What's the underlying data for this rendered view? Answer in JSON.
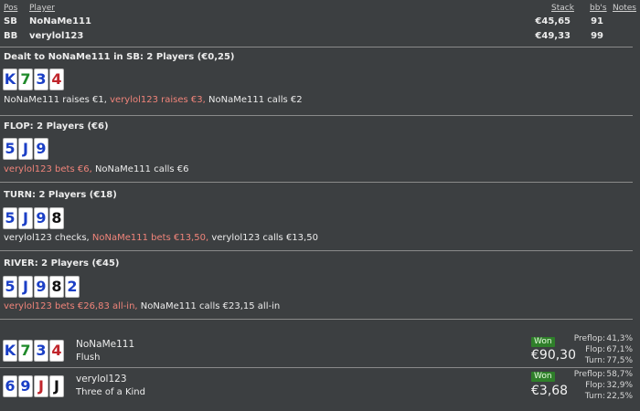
{
  "header": {
    "pos": "Pos",
    "player": "Player",
    "stack": "Stack",
    "bbs": "bb's",
    "notes": "Notes"
  },
  "players": [
    {
      "pos": "SB",
      "name": "NoNaMe111",
      "stack": "€45,65",
      "bbs": "91"
    },
    {
      "pos": "BB",
      "name": "verylol123",
      "stack": "€49,33",
      "bbs": "99"
    }
  ],
  "preflop": {
    "title": "Dealt to NoNaMe111 in SB: 2 Players (€0,25)",
    "cards": [
      {
        "rank": "K",
        "color": "blue"
      },
      {
        "rank": "7",
        "color": "green"
      },
      {
        "rank": "3",
        "color": "blue"
      },
      {
        "rank": "4",
        "color": "red"
      }
    ],
    "actions": [
      {
        "text": "NoNaMe111 raises €1,",
        "hl": false
      },
      {
        "text": "verylol123 raises €3,",
        "hl": true
      },
      {
        "text": "NoNaMe111 calls €2",
        "hl": false
      }
    ]
  },
  "flop": {
    "title": "FLOP: 2 Players (€6)",
    "cards": [
      {
        "rank": "5",
        "color": "blue"
      },
      {
        "rank": "J",
        "color": "blue"
      },
      {
        "rank": "9",
        "color": "blue"
      }
    ],
    "actions": [
      {
        "text": "verylol123 bets €6,",
        "hl": true
      },
      {
        "text": "NoNaMe111 calls €6",
        "hl": false
      }
    ]
  },
  "turn": {
    "title": "TURN: 2 Players (€18)",
    "cards": [
      {
        "rank": "5",
        "color": "blue"
      },
      {
        "rank": "J",
        "color": "blue"
      },
      {
        "rank": "9",
        "color": "blue"
      },
      {
        "rank": "8",
        "color": "black"
      }
    ],
    "actions": [
      {
        "text": "verylol123 checks,",
        "hl": false
      },
      {
        "text": "NoNaMe111 bets €13,50,",
        "hl": true
      },
      {
        "text": "verylol123 calls €13,50",
        "hl": false
      }
    ]
  },
  "river": {
    "title": "RIVER: 2 Players (€45)",
    "cards": [
      {
        "rank": "5",
        "color": "blue"
      },
      {
        "rank": "J",
        "color": "blue"
      },
      {
        "rank": "9",
        "color": "blue"
      },
      {
        "rank": "8",
        "color": "black"
      },
      {
        "rank": "2",
        "color": "blue"
      }
    ],
    "actions": [
      {
        "text": "verylol123 bets €26,83 all-in,",
        "hl": true
      },
      {
        "text": "NoNaMe111 calls €23,15 all-in",
        "hl": false
      }
    ]
  },
  "showdown": [
    {
      "cards": [
        {
          "rank": "K",
          "color": "blue"
        },
        {
          "rank": "7",
          "color": "green"
        },
        {
          "rank": "3",
          "color": "blue"
        },
        {
          "rank": "4",
          "color": "red"
        }
      ],
      "name": "NoNaMe111",
      "hand": "Flush",
      "result": "Won",
      "amount": "€90,30",
      "equity": [
        {
          "label": "Preflop:",
          "value": "41,3%"
        },
        {
          "label": "Flop:",
          "value": "67,1%"
        },
        {
          "label": "Turn:",
          "value": "77,5%"
        }
      ]
    },
    {
      "cards": [
        {
          "rank": "6",
          "color": "blue"
        },
        {
          "rank": "9",
          "color": "blue"
        },
        {
          "rank": "J",
          "color": "red"
        },
        {
          "rank": "J",
          "color": "black"
        }
      ],
      "name": "verylol123",
      "hand": "Three of a Kind",
      "result": "Won",
      "amount": "€3,68",
      "equity": [
        {
          "label": "Preflop:",
          "value": "58,7%"
        },
        {
          "label": "Flop:",
          "value": "32,9%"
        },
        {
          "label": "Turn:",
          "value": "22,5%"
        }
      ]
    }
  ],
  "colors": {
    "blue": "#1b3fc6",
    "green": "#1f8a2a",
    "red": "#c0252b",
    "black": "#111111",
    "highlight": "#f0847a",
    "won_badge": "#2f7f2a"
  }
}
